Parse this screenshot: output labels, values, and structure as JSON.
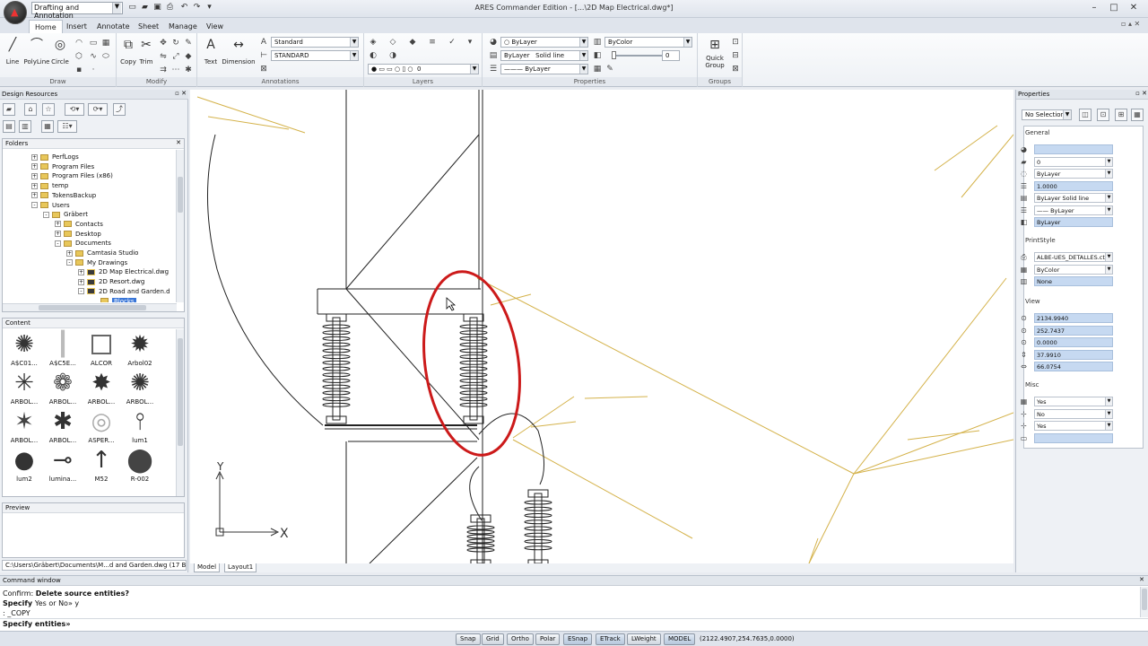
{
  "app": {
    "workspace": "Drafting and Annotation",
    "window_title": "ARES Commander Edition - [...\\2D Map Electrical.dwg*]"
  },
  "ribbon": {
    "tabs": [
      "Home",
      "Insert",
      "Annotate",
      "Sheet",
      "Manage",
      "View"
    ],
    "active_tab": "Home",
    "groups": {
      "draw": {
        "label": "Draw",
        "buttons": [
          "Line",
          "PolyLine",
          "Circle"
        ]
      },
      "modify": {
        "label": "Modify",
        "buttons": [
          "Copy",
          "Trim"
        ]
      },
      "annotations": {
        "label": "Annotations",
        "buttons": [
          "Text",
          "Dimension"
        ],
        "text_style": "Standard",
        "dim_style": "STANDARD"
      },
      "layers": {
        "label": "Layers",
        "current_layer": "0"
      },
      "properties": {
        "label": "Properties",
        "layer_color": "ByLayer",
        "color": "ByColor",
        "linetype_layer": "ByLayer",
        "linetype": "Solid line",
        "lineweight": "ByLayer",
        "transparency": "0"
      },
      "groups": {
        "label": "Groups",
        "buttons": [
          "Quick Group"
        ]
      }
    }
  },
  "design_resources": {
    "title": "Design Resources",
    "folders_title": "Folders",
    "tree": [
      {
        "label": "PerfLogs",
        "indent": 0,
        "expand": "+"
      },
      {
        "label": "Program Files",
        "indent": 0,
        "expand": "+"
      },
      {
        "label": "Program Files (x86)",
        "indent": 0,
        "expand": "+"
      },
      {
        "label": "temp",
        "indent": 0,
        "expand": "+"
      },
      {
        "label": "TokensBackup",
        "indent": 0,
        "expand": "+"
      },
      {
        "label": "Users",
        "indent": 0,
        "expand": "-"
      },
      {
        "label": "Gräbert",
        "indent": 1,
        "expand": "-"
      },
      {
        "label": "Contacts",
        "indent": 2,
        "expand": "+"
      },
      {
        "label": "Desktop",
        "indent": 2,
        "expand": "+"
      },
      {
        "label": "Documents",
        "indent": 2,
        "expand": "-"
      },
      {
        "label": "Camtasia Studio",
        "indent": 3,
        "expand": "+"
      },
      {
        "label": "My Drawings",
        "indent": 3,
        "expand": "-"
      },
      {
        "label": "2D Map Electrical.dwg",
        "indent": 4,
        "expand": "+",
        "dwg": true
      },
      {
        "label": "2D Resort.dwg",
        "indent": 4,
        "expand": "+",
        "dwg": true
      },
      {
        "label": "2D Road and Garden.d",
        "indent": 4,
        "expand": "-",
        "dwg": true
      },
      {
        "label": "Blocks",
        "indent": 5,
        "expand": "",
        "selected": true
      }
    ],
    "content_title": "Content",
    "content_items": [
      "A$C01...",
      "A$C5E...",
      "ALCOR",
      "Arbol02",
      "ARBOL...",
      "ARBOL...",
      "ARBOL...",
      "ARBOL...",
      "ARBOL...",
      "ARBOL...",
      "ASPER...",
      "lum1",
      "lum2",
      "lumina...",
      "M52",
      "R-002"
    ],
    "preview_title": "Preview",
    "path": "C:\\Users\\Gräbert\\Documents\\M...d and Garden.dwg (17 Blocks)"
  },
  "layout_tabs": [
    "Model",
    "Layout1"
  ],
  "ucs": {
    "x": "X",
    "y": "Y"
  },
  "properties": {
    "title": "Properties",
    "selection": "No Selection",
    "general": {
      "title": "General",
      "values": [
        "",
        "0",
        "ByLayer",
        "1.0000",
        "ByLayer    Solid line",
        "—— ByLayer",
        "ByLayer"
      ]
    },
    "printstyle": {
      "title": "PrintStyle",
      "values": [
        "ALBE-UES_DETALLES.ctb",
        "ByColor",
        "None"
      ]
    },
    "view": {
      "title": "View",
      "values": [
        "2134.9940",
        "252.7437",
        "0.0000",
        "37.9910",
        "66.0754"
      ]
    },
    "misc": {
      "title": "Misc",
      "values": [
        "Yes",
        "No",
        "Yes",
        ""
      ]
    }
  },
  "command": {
    "title": "Command window",
    "lines": [
      {
        "prefix": "Confirm: ",
        "text": "Delete source entities?"
      },
      {
        "prefix": "Specify ",
        "text": "Yes or No» y"
      },
      {
        "prefix": ": ",
        "text": "_COPY"
      }
    ],
    "prompt": "Specify entities»"
  },
  "status": {
    "buttons": [
      "Snap",
      "Grid",
      "Ortho",
      "Polar",
      "ESnap",
      "ETrack",
      "LWeight",
      "MODEL"
    ],
    "coords": "(2122.4907,254.7635,0.0000)"
  },
  "colors": {
    "annotation_red": "#cc1a1a",
    "tree_yellow": "#d4b24a",
    "selection_blue": "#3875d7",
    "property_highlight": "#c6d9f1"
  }
}
